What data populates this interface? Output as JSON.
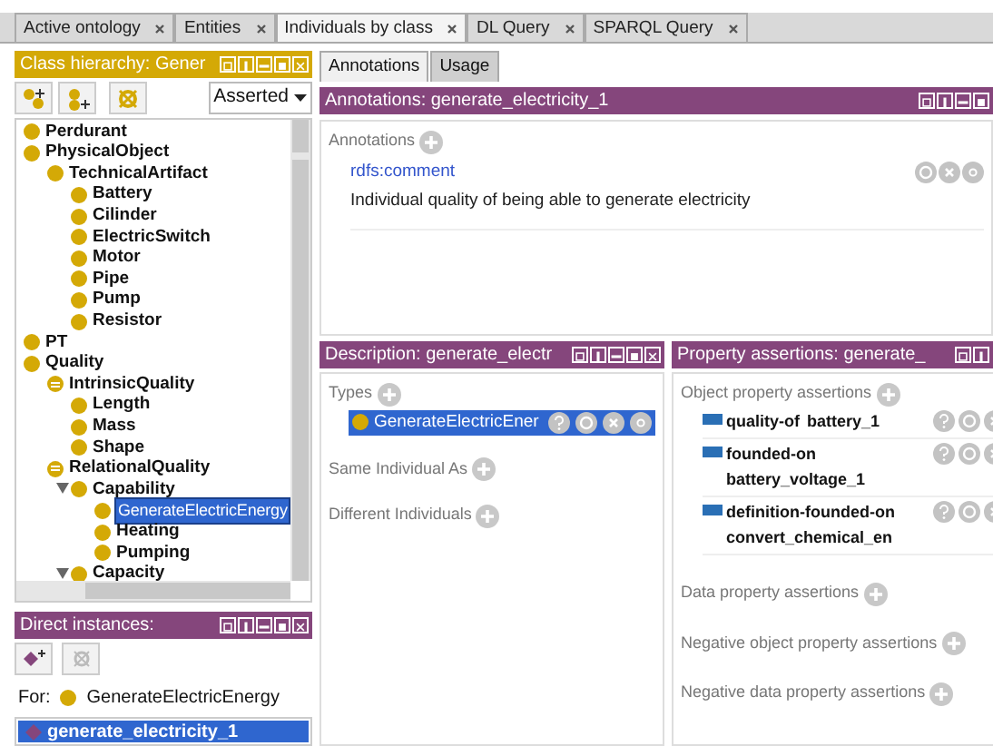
{
  "tabs": [
    {
      "label": "Active ontology",
      "selected": false
    },
    {
      "label": "Entities",
      "selected": false
    },
    {
      "label": "Individuals by class",
      "selected": true
    },
    {
      "label": "DL Query",
      "selected": false
    },
    {
      "label": "SPARQL Query",
      "selected": false
    }
  ],
  "class_hierarchy": {
    "title": "Class hierarchy: Gener",
    "mode": "Asserted",
    "tree": [
      {
        "label": "Perdurant",
        "kind": "class",
        "selected": false
      },
      {
        "label": "PhysicalObject",
        "kind": "class",
        "selected": false,
        "children": [
          {
            "label": "TechnicalArtifact",
            "kind": "class",
            "selected": false,
            "children": [
              {
                "label": "Battery",
                "kind": "class",
                "selected": false
              },
              {
                "label": "Cilinder",
                "kind": "class",
                "selected": false
              },
              {
                "label": "ElectricSwitch",
                "kind": "class",
                "selected": false
              },
              {
                "label": "Motor",
                "kind": "class",
                "selected": false
              },
              {
                "label": "Pipe",
                "kind": "class",
                "selected": false
              },
              {
                "label": "Pump",
                "kind": "class",
                "selected": false
              },
              {
                "label": "Resistor",
                "kind": "class",
                "selected": false
              }
            ]
          }
        ]
      },
      {
        "label": "PT",
        "kind": "class",
        "selected": false
      },
      {
        "label": "Quality",
        "kind": "class",
        "selected": false,
        "children": [
          {
            "label": "IntrinsicQuality",
            "kind": "defined",
            "selected": false,
            "children": [
              {
                "label": "Length",
                "kind": "class",
                "selected": false
              },
              {
                "label": "Mass",
                "kind": "class",
                "selected": false
              },
              {
                "label": "Shape",
                "kind": "class",
                "selected": false
              }
            ]
          },
          {
            "label": "RelationalQuality",
            "kind": "defined",
            "selected": false,
            "children": [
              {
                "label": "Capability",
                "kind": "class",
                "expanded": true,
                "selected": false,
                "children": [
                  {
                    "label": "GenerateElectricEnergy",
                    "kind": "class",
                    "selected": true
                  },
                  {
                    "label": "Heating",
                    "kind": "class",
                    "selected": false
                  },
                  {
                    "label": "Pumping",
                    "kind": "class",
                    "selected": false
                  }
                ]
              },
              {
                "label": "Capacity",
                "kind": "class",
                "expanded": true,
                "selected": false
              }
            ]
          }
        ]
      }
    ]
  },
  "direct_instances": {
    "title": "Direct instances:",
    "for_label": "For:",
    "for_class": "GenerateElectricEnergy",
    "items": [
      {
        "label": "generate_electricity_1",
        "selected": true
      }
    ]
  },
  "subtabs": [
    {
      "label": "Annotations",
      "selected": true
    },
    {
      "label": "Usage",
      "selected": false
    }
  ],
  "annotations": {
    "title": "Annotations: generate_electricity_1",
    "section": "Annotations",
    "items": [
      {
        "property": "rdfs:comment",
        "value": "Individual quality of being able to generate electricity"
      }
    ]
  },
  "description": {
    "title": "Description: generate_electr",
    "sections": [
      {
        "label": "Types",
        "items": [
          {
            "label": "GenerateElectricEner",
            "selected": true
          }
        ]
      },
      {
        "label": "Same Individual As"
      },
      {
        "label": "Different Individuals"
      }
    ]
  },
  "property_assertions": {
    "title": "Property assertions: generate_",
    "sections": [
      {
        "label": "Object property assertions",
        "items": [
          {
            "property": "quality-of",
            "value": "battery_1"
          },
          {
            "property": "founded-on",
            "value": "battery_voltage_1"
          },
          {
            "property": "definition-founded-on",
            "value": "convert_chemical_en"
          }
        ]
      },
      {
        "label": "Data property assertions"
      },
      {
        "label": "Negative object property assertions"
      },
      {
        "label": "Negative data property assertions"
      }
    ]
  }
}
